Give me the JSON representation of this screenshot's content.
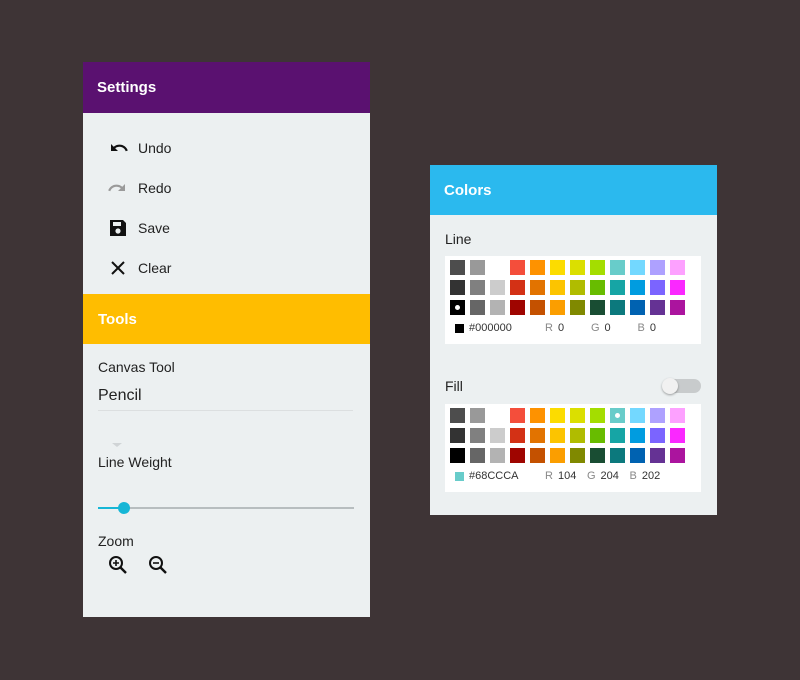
{
  "settings": {
    "title": "Settings",
    "items": [
      {
        "label": "Undo",
        "icon": "undo-icon"
      },
      {
        "label": "Redo",
        "icon": "redo-icon"
      },
      {
        "label": "Save",
        "icon": "save-icon"
      },
      {
        "label": "Clear",
        "icon": "close-icon"
      }
    ]
  },
  "tools": {
    "title": "Tools",
    "canvas_tool_label": "Canvas Tool",
    "canvas_tool_value": "Pencil",
    "line_weight_label": "Line Weight",
    "line_weight_value": 0.1,
    "zoom_label": "Zoom",
    "zoom_icons": [
      "zoom-in-icon",
      "zoom-out-icon"
    ]
  },
  "colors": {
    "title": "Colors",
    "line": {
      "label": "Line",
      "hex": "#000000",
      "r_label": "R",
      "r": "0",
      "g_label": "G",
      "g": "0",
      "b_label": "B",
      "b": "0",
      "selected": "#000000"
    },
    "fill": {
      "label": "Fill",
      "enabled": false,
      "hex": "#68CCCA",
      "r_label": "R",
      "r": "104",
      "g_label": "G",
      "g": "204",
      "b_label": "B",
      "b": "202",
      "selected": "#68CCCA"
    },
    "palette": [
      "#4d4d4d",
      "#999999",
      "#ffffff",
      "#f44e3b",
      "#fe9200",
      "#fcdc00",
      "#dbdf00",
      "#a4dd00",
      "#68ccca",
      "#73d8ff",
      "#aea1ff",
      "#fda1ff",
      "#333333",
      "#808080",
      "#cccccc",
      "#d33115",
      "#e27300",
      "#fcc400",
      "#b0bc00",
      "#68bc00",
      "#16a5a5",
      "#009ce0",
      "#7b64ff",
      "#fa28ff",
      "#000000",
      "#666666",
      "#b3b3b3",
      "#9f0500",
      "#c45100",
      "#fb9e00",
      "#808900",
      "#194d33",
      "#0c797d",
      "#0062b1",
      "#653294",
      "#ab149e"
    ]
  },
  "accent": {
    "settings": "#5a1170",
    "tools": "#ffbd00",
    "colors": "#2bb9ee",
    "slider": "#16b6d6",
    "background": "#3e3436"
  }
}
